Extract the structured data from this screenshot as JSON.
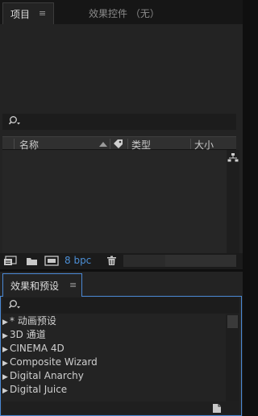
{
  "project_panel": {
    "tabs": [
      {
        "label": "项目",
        "menu_icon": "≡"
      },
      {
        "label": "效果控件 （无）"
      }
    ],
    "search_icon": "search-icon",
    "columns": [
      {
        "label": "名称"
      },
      {
        "label": ""
      },
      {
        "label": "类型"
      },
      {
        "label": "大小"
      }
    ],
    "bottom": {
      "bit_depth": "8 bpc"
    }
  },
  "effects_panel": {
    "tab": {
      "label": "效果和预设",
      "menu_icon": "≡"
    },
    "tree": [
      {
        "label": "* 动画预设"
      },
      {
        "label": "3D 通道"
      },
      {
        "label": "CINEMA 4D"
      },
      {
        "label": "Composite Wizard"
      },
      {
        "label": "Digital Anarchy"
      },
      {
        "label": "Digital Juice"
      }
    ]
  },
  "colors": {
    "accent_blue": "#4a88d4",
    "bpc_blue": "#4c8fd6",
    "panel_bg": "#232323"
  }
}
